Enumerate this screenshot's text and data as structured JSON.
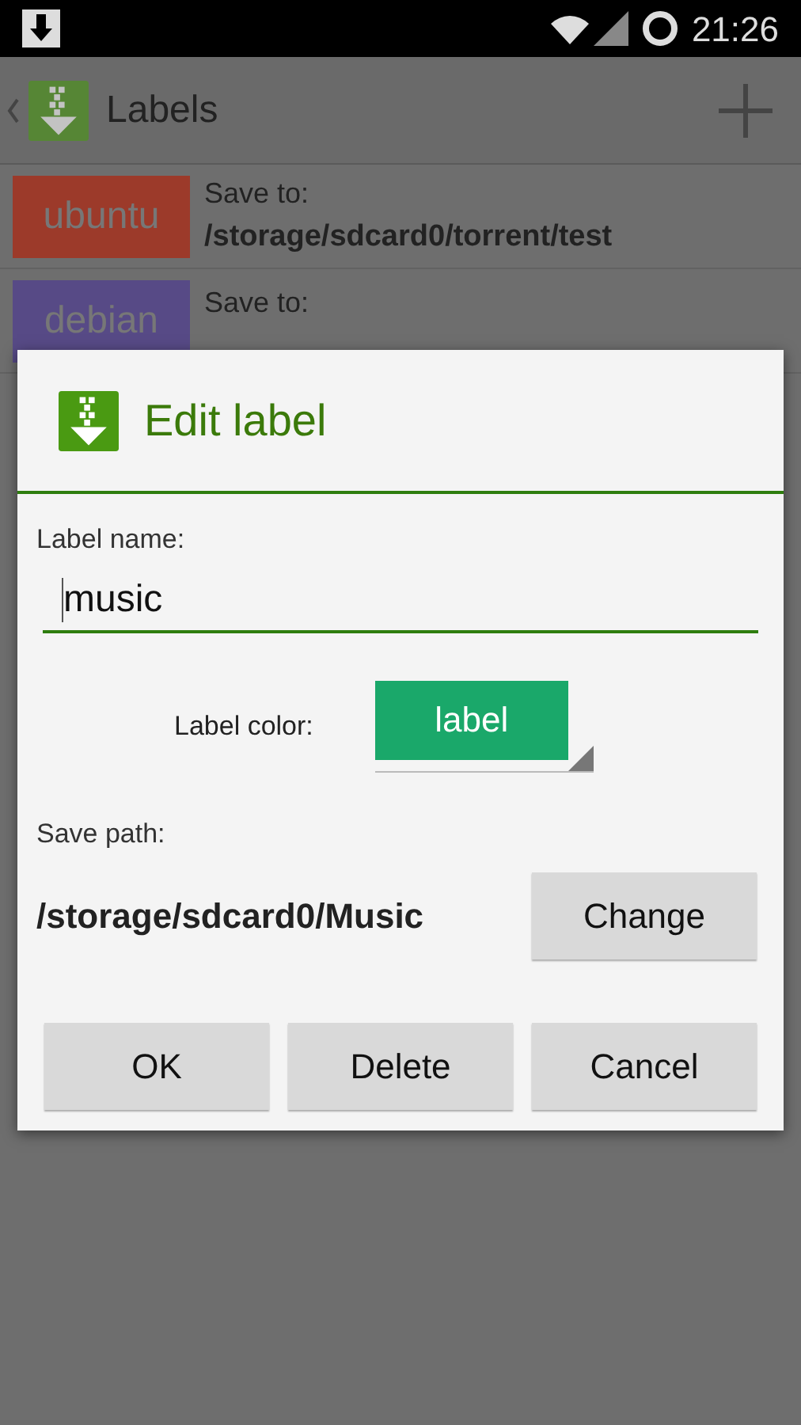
{
  "status_bar": {
    "time": "21:26"
  },
  "action_bar": {
    "title": "Labels"
  },
  "labels": [
    {
      "name": "ubuntu",
      "color": "#9c3a2a",
      "caption": "Save to:",
      "path": "/storage/sdcard0/torrent/test"
    },
    {
      "name": "debian",
      "color": "#574a86",
      "caption": "Save to:"
    }
  ],
  "dialog": {
    "title": "Edit label",
    "name_label": "Label name:",
    "name_value": "music",
    "color_label": "Label color:",
    "color_chip": {
      "text": "label",
      "color": "#1aa86a"
    },
    "path_label": "Save path:",
    "path": "/storage/sdcard0/Music",
    "change_button": "Change",
    "buttons": [
      "OK",
      "Delete",
      "Cancel"
    ]
  }
}
